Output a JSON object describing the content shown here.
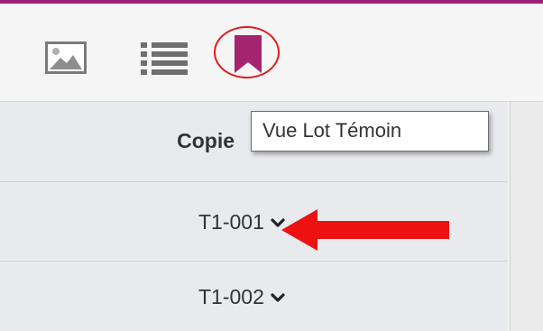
{
  "colors": {
    "accent_purple": "#a5246f",
    "annotation_red": "#e01c1c",
    "top_border": "#9e1e7a"
  },
  "toolbar": {
    "tools": [
      {
        "icon": "image-icon"
      },
      {
        "icon": "list-icon"
      },
      {
        "icon": "bookmark-icon",
        "highlighted": true
      }
    ]
  },
  "tooltip": {
    "text": "Vue Lot Témoin"
  },
  "table": {
    "header": "Copie",
    "rows": [
      {
        "label": "T1-001",
        "icon": "chevron-down-icon"
      },
      {
        "label": "T1-002",
        "icon": "chevron-down-icon"
      }
    ]
  },
  "annotations": {
    "arrow": "arrow-left-icon",
    "circle": "highlight-circle"
  }
}
